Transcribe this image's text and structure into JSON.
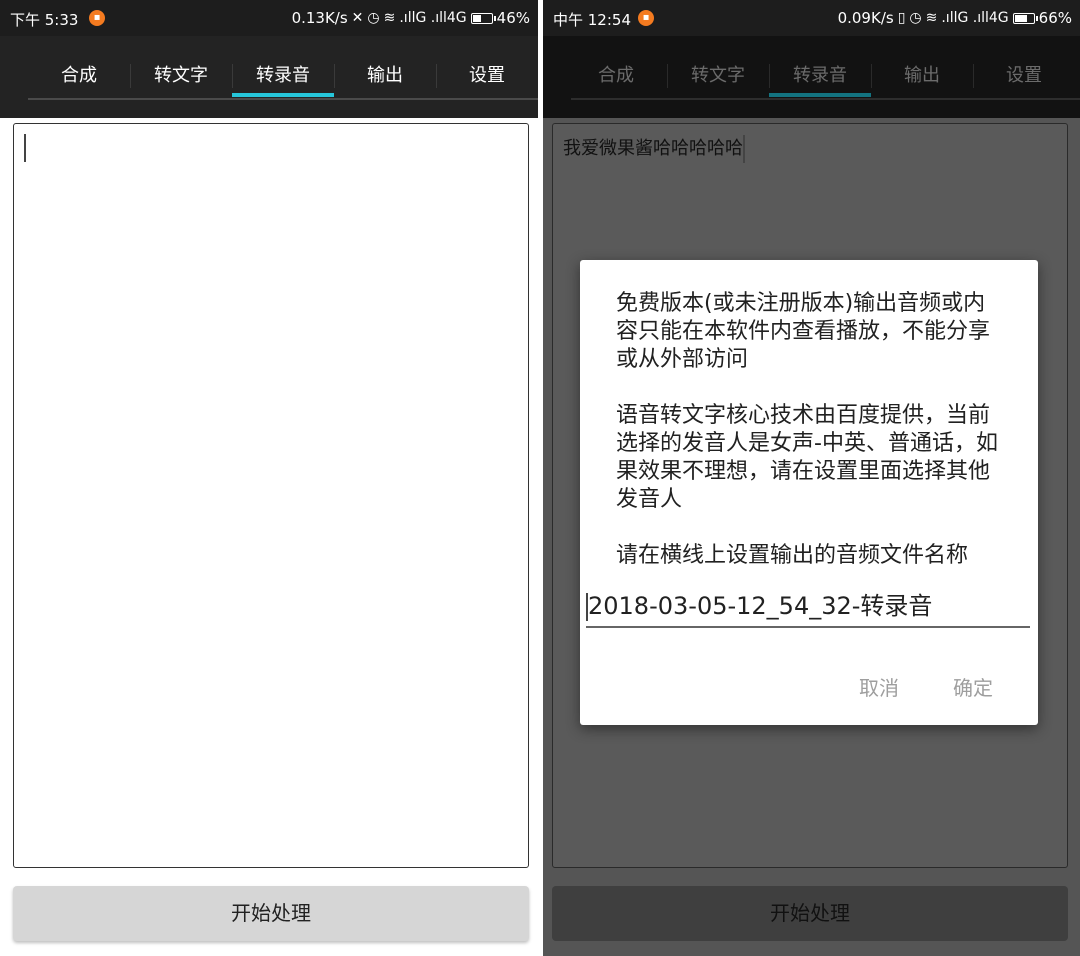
{
  "left": {
    "status": {
      "time": "下午 5:33",
      "net_speed": "0.13K/s",
      "signal_text": ".ıllG .ıll4G",
      "battery": "46%",
      "battery_level": 0.46
    },
    "tabs": [
      "合成",
      "转文字",
      "转录音",
      "输出",
      "设置"
    ],
    "active_tab": "转录音",
    "editor_text": "",
    "start_button": "开始处理"
  },
  "right": {
    "status": {
      "time": "中午 12:54",
      "net_speed": "0.09K/s",
      "signal_text": ".ıllG .ıll4G",
      "battery": "66%",
      "battery_level": 0.66
    },
    "tabs": [
      "合成",
      "转文字",
      "转录音",
      "输出",
      "设置"
    ],
    "active_tab": "转录音",
    "editor_text": "我爱微果酱哈哈哈哈哈",
    "start_button": "开始处理",
    "dialog": {
      "message_1": "免费版本(或未注册版本)输出音频或内容只能在本软件内查看播放，不能分享或从外部访问",
      "message_2": "语音转文字核心技术由百度提供，当前选择的发音人是女声-中英、普通话，如果效果不理想，请在设置里面选择其他发音人",
      "message_3": "请在横线上设置输出的音频文件名称",
      "filename_value": "2018-03-05-12_54_32-转录音",
      "cancel": "取消",
      "confirm": "确定"
    }
  },
  "colors": {
    "tab_indicator": "#26c6da",
    "notification_badge": "#f47b20"
  },
  "icons": [
    "notification-app-icon",
    "no-sound-icon",
    "vibrate-icon",
    "alarm-icon",
    "wifi-icon",
    "battery-icon"
  ]
}
